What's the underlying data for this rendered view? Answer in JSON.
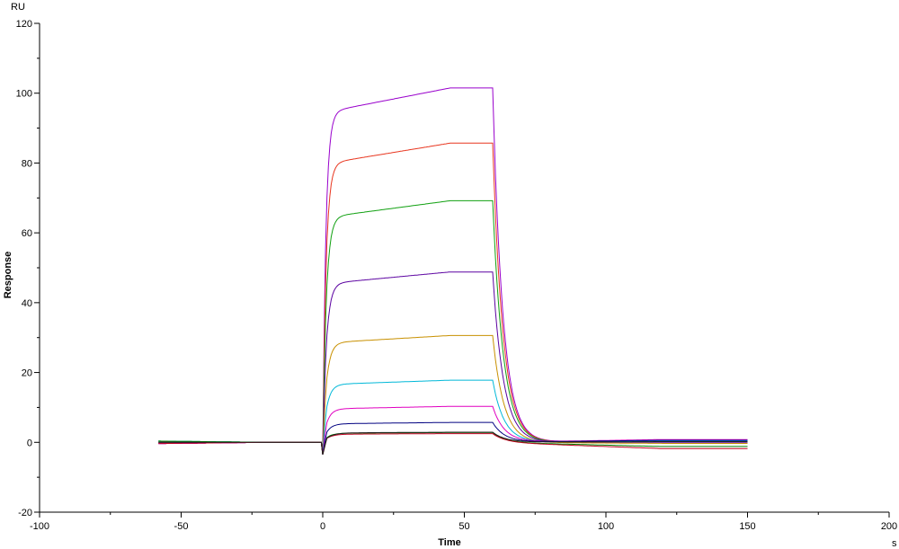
{
  "chart_data": {
    "type": "line",
    "title": "",
    "xlabel": "Time",
    "ylabel": "Response",
    "x_unit": "s",
    "y_unit": "RU",
    "xlim": [
      -100,
      200
    ],
    "ylim": [
      -20,
      120
    ],
    "x_ticks": [
      "-100",
      "-50",
      "0",
      "50",
      "100",
      "150",
      "200"
    ],
    "y_ticks": [
      "-20",
      "0",
      "20",
      "40",
      "60",
      "80",
      "100",
      "120"
    ],
    "grid": false,
    "legend": "none",
    "x_range": [
      -58,
      150
    ],
    "association_start": 0,
    "dissociation_start": 60,
    "series": [
      {
        "color": "#9900cc",
        "plateau": 101.5,
        "end_value": 0.5
      },
      {
        "color": "#e8351e",
        "plateau": 85.7,
        "end_value": 0.3
      },
      {
        "color": "#10a010",
        "plateau": 69.2,
        "end_value": 0.2
      },
      {
        "color": "#5a00a0",
        "plateau": 48.8,
        "end_value": 0.0
      },
      {
        "color": "#c89000",
        "plateau": 30.6,
        "end_value": -0.3
      },
      {
        "color": "#00b8d8",
        "plateau": 17.8,
        "end_value": 0.4
      },
      {
        "color": "#e000c0",
        "plateau": 10.3,
        "end_value": 0.8
      },
      {
        "color": "#000080",
        "plateau": 5.7,
        "end_value": 0.6
      },
      {
        "color": "#008000",
        "plateau": 2.8,
        "end_value": -1.2
      },
      {
        "color": "#c00020",
        "plateau": 2.5,
        "end_value": -1.8
      },
      {
        "color": "#202020",
        "plateau": 2.9,
        "end_value": 0.2
      }
    ]
  }
}
